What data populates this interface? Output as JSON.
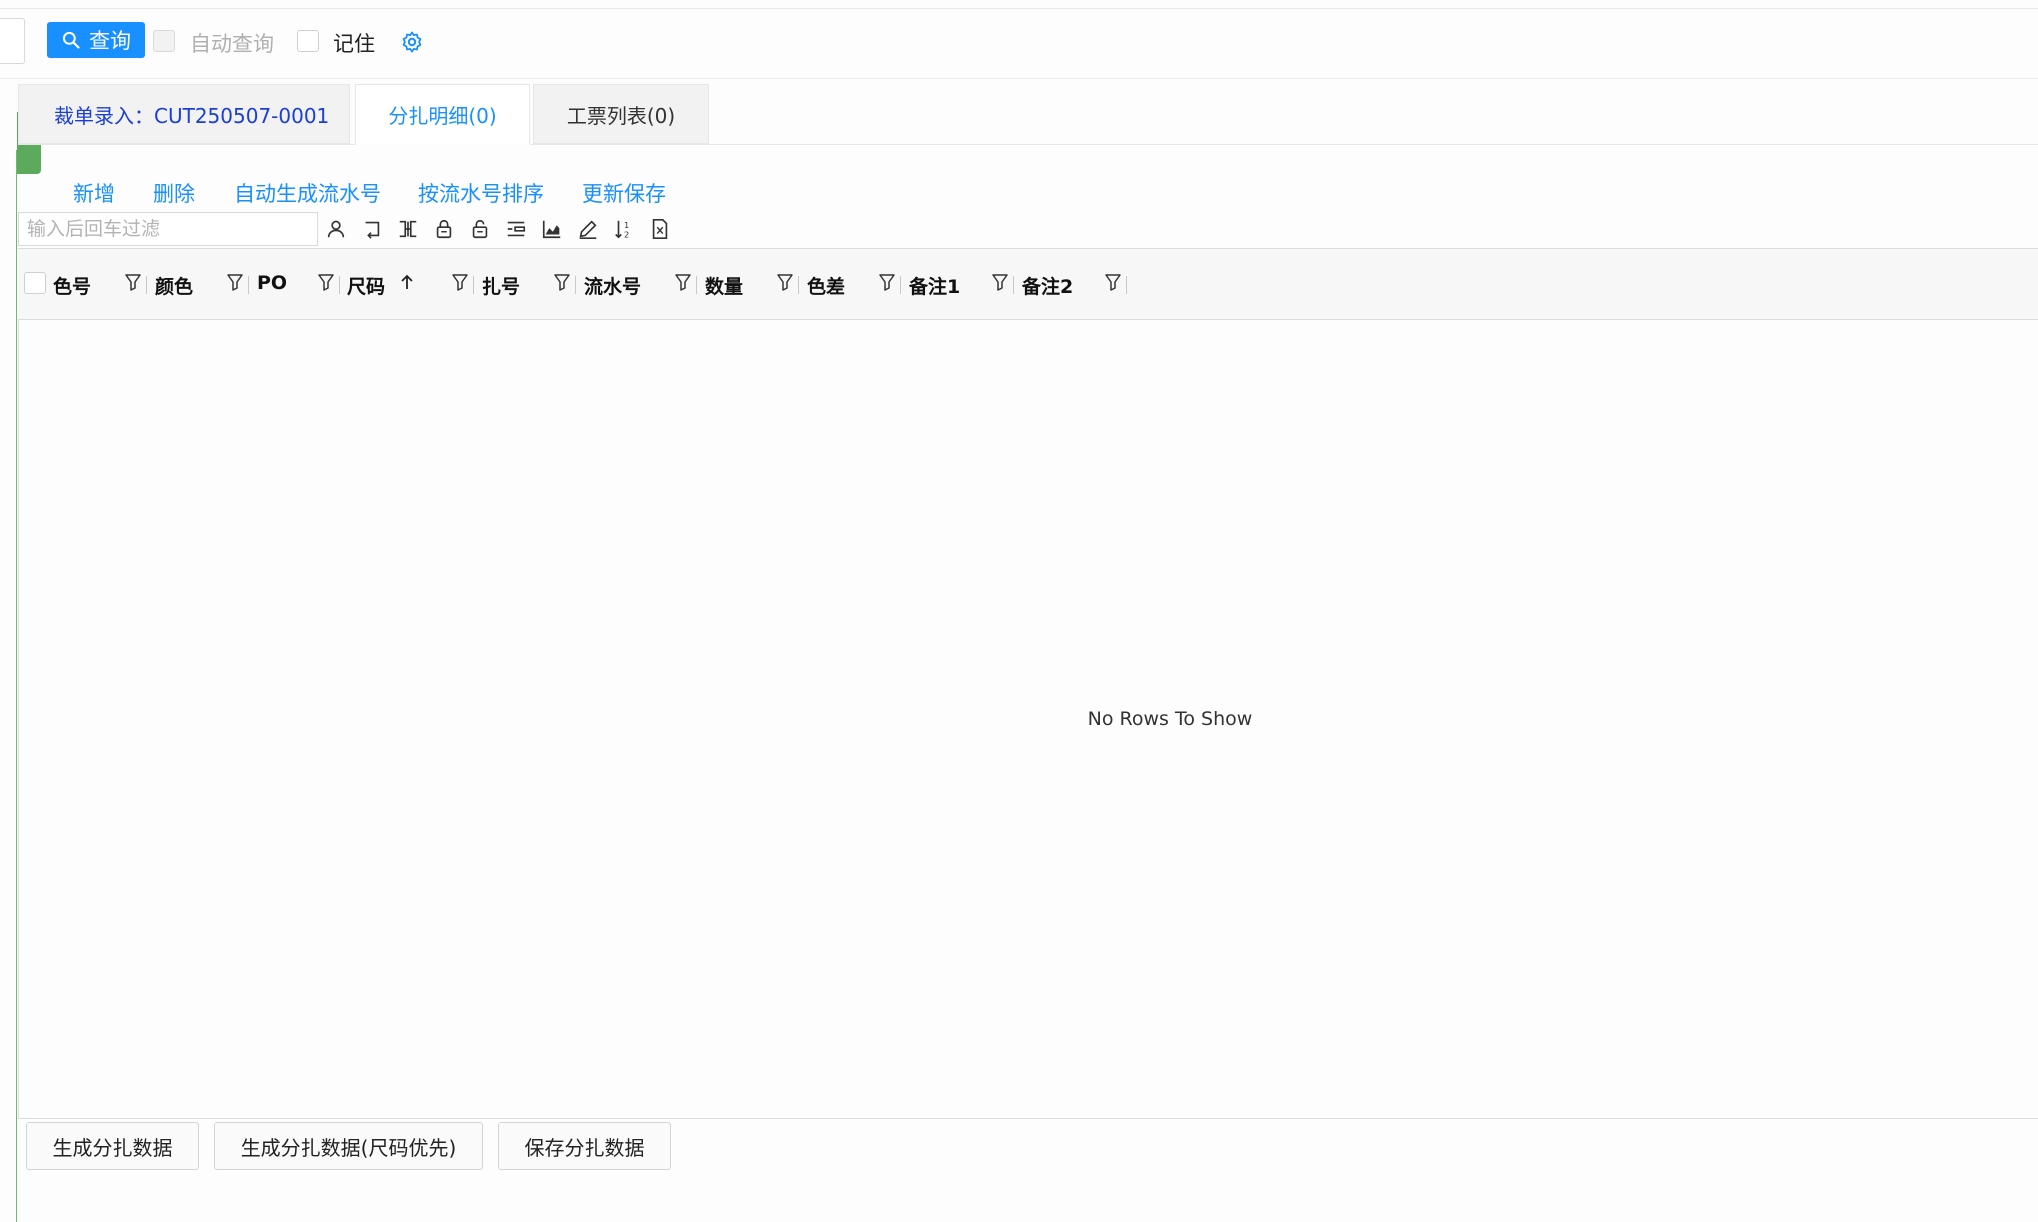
{
  "toolbar": {
    "query_label": "查询",
    "auto_query_label": "自动查询",
    "remember_label": "记住"
  },
  "tabs": [
    {
      "label": "裁单录入：CUT250507-0001",
      "state": "inactive"
    },
    {
      "label": "分扎明细(0)",
      "state": "active"
    },
    {
      "label": "工票列表(0)",
      "state": "inactive"
    }
  ],
  "actions": [
    "新增",
    "删除",
    "自动生成流水号",
    "按流水号排序",
    "更新保存"
  ],
  "grid": {
    "filter_placeholder": "输入后回车过滤",
    "toolbar_icons": [
      "user-icon",
      "return-icon",
      "columns-icon",
      "lock-icon",
      "unlock-icon",
      "list-icon",
      "chart-icon",
      "edit-icon",
      "sort-icon",
      "excel-icon"
    ],
    "columns": [
      "色号",
      "颜色",
      "PO",
      "尺码",
      "扎号",
      "流水号",
      "数量",
      "色差",
      "备注1",
      "备注2"
    ],
    "sorted_column": "尺码",
    "sort_direction": "asc",
    "empty_text": "No Rows To Show"
  },
  "bottom_buttons": [
    "生成分扎数据",
    "生成分扎数据(尺码优先)",
    "保存分扎数据"
  ],
  "colors": {
    "accent": "#1890ff",
    "tab_title": "#1a3fd6",
    "collapse": "#5cab5c"
  }
}
